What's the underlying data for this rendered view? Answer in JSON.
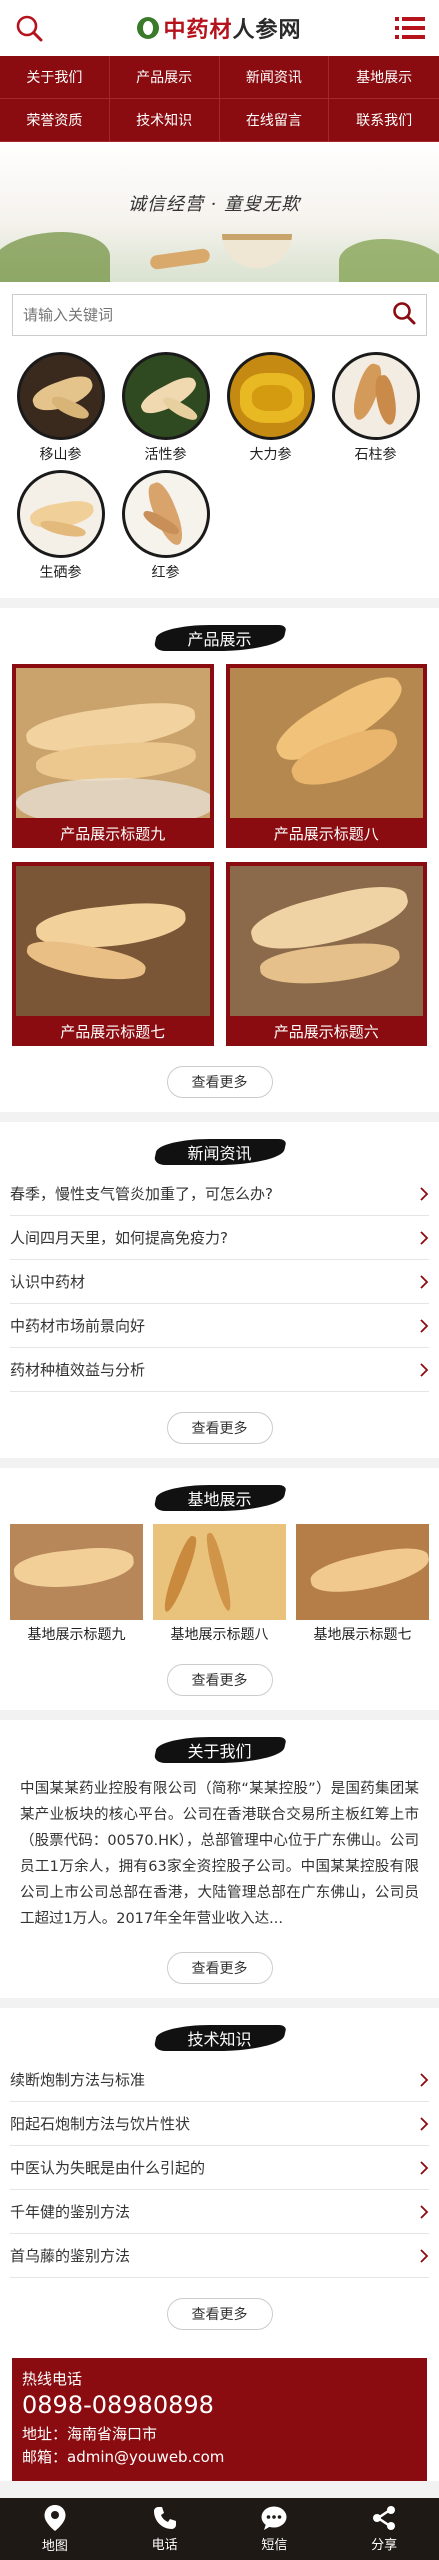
{
  "header": {
    "logo_part1": "中药材",
    "logo_part2": "人参网",
    "search_icon": "search-icon",
    "menu_icon": "menu-icon"
  },
  "nav": [
    {
      "label": "关于我们"
    },
    {
      "label": "产品展示"
    },
    {
      "label": "新闻资讯"
    },
    {
      "label": "基地展示"
    },
    {
      "label": "荣誉资质"
    },
    {
      "label": "技术知识"
    },
    {
      "label": "在线留言"
    },
    {
      "label": "联系我们"
    }
  ],
  "banner": {
    "slogan": "诚信经营 · 童叟无欺"
  },
  "search": {
    "placeholder": "请输入关键词"
  },
  "categories": [
    {
      "label": "移山参"
    },
    {
      "label": "活性参"
    },
    {
      "label": "大力参"
    },
    {
      "label": "石柱参"
    },
    {
      "label": "生硒参"
    },
    {
      "label": "红参"
    }
  ],
  "products": {
    "title": "产品展示",
    "items": [
      {
        "label": "产品展示标题九"
      },
      {
        "label": "产品展示标题八"
      },
      {
        "label": "产品展示标题七"
      },
      {
        "label": "产品展示标题六"
      }
    ],
    "more": "查看更多"
  },
  "news": {
    "title": "新闻资讯",
    "items": [
      {
        "label": "春季，慢性支气管炎加重了，可怎么办?"
      },
      {
        "label": "人间四月天里，如何提高免疫力?"
      },
      {
        "label": "认识中药材"
      },
      {
        "label": "中药材市场前景向好"
      },
      {
        "label": "药材种植效益与分析"
      }
    ],
    "more": "查看更多"
  },
  "bases": {
    "title": "基地展示",
    "items": [
      {
        "label": "基地展示标题九"
      },
      {
        "label": "基地展示标题八"
      },
      {
        "label": "基地展示标题七"
      }
    ],
    "more": "查看更多"
  },
  "about": {
    "title": "关于我们",
    "text": "中国某某药业控股有限公司（简称“某某控股”）是国药集团某某产业板块的核心平台。公司在香港联合交易所主板红筹上市（股票代码：00570.HK），总部管理中心位于广东佛山。公司员工1万余人，拥有63家全资控股子公司。中国某某控股有限公司上市公司总部在香港，大陆管理总部在广东佛山，公司员工超过1万人。2017年全年营业收入达...",
    "more": "查看更多"
  },
  "tech": {
    "title": "技术知识",
    "items": [
      {
        "label": "续断炮制方法与标准"
      },
      {
        "label": "阳起石炮制方法与饮片性状"
      },
      {
        "label": "中医认为失眠是由什么引起的"
      },
      {
        "label": "千年健的鉴别方法"
      },
      {
        "label": "首乌藤的鉴别方法"
      }
    ],
    "more": "查看更多"
  },
  "contact": {
    "hotline_label": "热线电话",
    "phone": "0898-08980898",
    "address": "地址：海南省海口市",
    "email": "邮箱：admin@youweb.com"
  },
  "footer": [
    {
      "label": "地图",
      "icon": "map-pin-icon"
    },
    {
      "label": "电话",
      "icon": "phone-icon"
    },
    {
      "label": "短信",
      "icon": "message-icon"
    },
    {
      "label": "分享",
      "icon": "share-icon"
    }
  ],
  "colors": {
    "brand_red": "#8b0c10",
    "footer_dark": "#1f1916"
  }
}
